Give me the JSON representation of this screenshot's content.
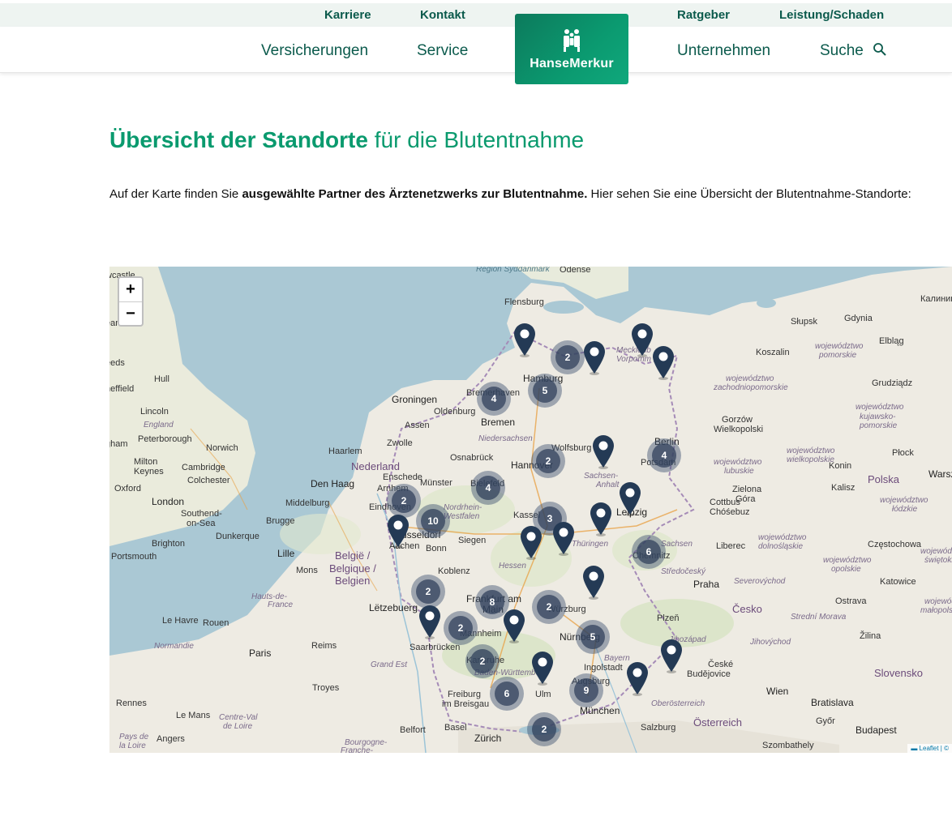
{
  "topnav": {
    "karriere": "Karriere",
    "kontakt": "Kontakt",
    "ratgeber": "Ratgeber",
    "leistung": "Leistung/Schaden"
  },
  "mainnav": {
    "versicherungen": "Versicherungen",
    "service": "Service",
    "unternehmen": "Unternehmen",
    "suche": "Suche"
  },
  "logo": {
    "text": "HanseMerkur"
  },
  "page": {
    "title_bold": "Übersicht der Standorte",
    "title_rest": " für die Blutentnahme",
    "intro_pre": "Auf der Karte finden Sie ",
    "intro_bold": "ausgewählte Partner des Ärztenetzwerks zur Blutentnahme.",
    "intro_post": "  Hier sehen Sie eine Übersicht der Blutentnahme-Standorte:"
  },
  "map": {
    "zoom_in": "+",
    "zoom_out": "−",
    "attribution": "▬ Leaflet | ©",
    "clusters": [
      "2",
      "4",
      "5",
      "2",
      "4",
      "4",
      "2",
      "10",
      "3",
      "6",
      "2",
      "8",
      "2",
      "2",
      "5",
      "2",
      "6",
      "9",
      "2"
    ],
    "labels": {
      "odense": "Odense",
      "flensburg": "Flensburg",
      "region_syd": "Region Syddanmark",
      "hamburg": "Hamburg",
      "bremen": "Bremen",
      "bremerhaven": "Bremerhaven",
      "oldenburg": "Oldenburg",
      "groningen": "Groningen",
      "assen": "Assen",
      "zwolle": "Zwolle",
      "haarlem": "Haarlem",
      "nederland": "Nederland",
      "den_haag": "Den Haag",
      "middelburg": "Middelburg",
      "brugge": "Brugge",
      "dunkerque": "Dunkerque",
      "lille": "Lille",
      "belgie": "België /",
      "belgique": "Belgique /",
      "belgien": "Belgien",
      "mons": "Mons",
      "letzebuerg": "Lëtzebuerg",
      "reims": "Reims",
      "paris": "Paris",
      "rouen": "Rouen",
      "le_havre": "Le Havre",
      "troyes": "Troyes",
      "le_mans": "Le Mans",
      "rennes": "Rennes",
      "angers": "Angers",
      "normandie": "Normandie",
      "grand_est": "Grand Est",
      "hauts_de": "Hauts-de-",
      "france": "France",
      "centre": "Centre-Val",
      "de_loire": "de Loire",
      "pays": "Pays de",
      "la_loire": "la Loire",
      "bourgogne": "Bourgogne-",
      "franche": "Franche-",
      "london": "London",
      "leeds": "eeds",
      "sheffield": "heffield",
      "hull": "Hull",
      "lincoln": "Lincoln",
      "england": "England",
      "gham": "gham",
      "peterborough": "Peterborough",
      "norwich": "Norwich",
      "milton": "Milton",
      "keynes": "Keynes",
      "cambridge": "Cambridge",
      "colchester": "Colchester",
      "oxford": "Oxford",
      "southend": "Southend-",
      "on_sea": "on-Sea",
      "brighton": "Brighton",
      "portsmouth": "Portsmouth",
      "ewcastle": "wcastle",
      "eam": "eam",
      "enschede": "Enschede",
      "osnabrueck": "Osnabrück",
      "muenster": "Münster",
      "arnhem": "Arnhem",
      "eindhoven": "Eindhoven",
      "duesseldorf": "üsseldorf",
      "aachen": "Aachen",
      "bonn": "Bonn",
      "siegen": "Siegen",
      "koblenz": "Koblenz",
      "hannover": "Hannover",
      "wolfsburg": "Wolfsburg",
      "niedersachsen": "Niedersachsen",
      "bielefeld": "Bielefeld",
      "nordrhein": "Nordrhein-",
      "westfalen": "Westfalen",
      "kassel": "Kassel",
      "hessen": "Hessen",
      "frankfurt": "Frankfurt am",
      "main": "Main",
      "mannheim": "Mannheim",
      "saarbruecken": "Saarbrücken",
      "karlsruhe": "Karlsruhe",
      "baden": "Baden-Württemberg",
      "freiburg": "Freiburg",
      "im_breisgau": "im Breisgau",
      "basel": "Basel",
      "zuerich": "Zürich",
      "belfort": "Belfort",
      "ulm": "Ulm",
      "augsburg": "Augsburg",
      "muenchen": "München",
      "ingolstadt": "Ingolstadt",
      "nuernberg": "Nürnberg",
      "wuerzburg": "Würzburg",
      "bayern": "Bayern",
      "sachsen_anhalt": "Sachsen-",
      "anhalt": "Anhalt",
      "leipzig": "Leipzig",
      "thueringen": "Thüringen",
      "chemnitz": "Chemnitz",
      "sachsen": "Sachsen",
      "berlin": "Berlin",
      "potsdam": "Potsdam",
      "cottbus": "Cottbus",
      "chosebuz": "Chóśebuz",
      "mecklenburg": "Mecklenb",
      "vorpommern": "Vorpomm",
      "koszalin": "Koszalin",
      "slupsk": "Słupsk",
      "gdynia": "Gdynia",
      "elblag": "Elbląg",
      "pomorskie": "pomorskie",
      "wojewodztwo": "województwo",
      "zachodniopomorskie": "zachodniopomorskie",
      "grudziadz": "Grudziądz",
      "kujawsko": "kujawsko-",
      "gorzow": "Gorzów",
      "wielkopolski": "Wielkopolski",
      "wielkopolskie": "wielkopolskie",
      "lubuskie": "lubuskie",
      "konin": "Konin",
      "plock": "Płock",
      "warsz": "Warsz",
      "polska": "Polska",
      "kalisz": "Kalisz",
      "zielona": "Zielona",
      "gora": "Góra",
      "lodzkie": "łódzkie",
      "dolnoslaskie": "dolnośląskie",
      "liberec": "Liberec",
      "czestochowa": "Częstochowa",
      "opolskie": "opolskie",
      "slaskie": "śląskie",
      "swietokrz": "świętokrz",
      "katowice": "Katowice",
      "praha": "Praha",
      "cesko": "Česko",
      "stredocesky": "Středočeský",
      "severovychod": "Severovýchod",
      "plzen": "Plzeň",
      "jihovychod": "Jihovýchod",
      "ostrava": "Ostrava",
      "moravia": "Strední Morava",
      "malopolskie": "małopolskie",
      "zilina": "Žilina",
      "ceske": "České",
      "budejovice": "Budějovice",
      "jihozapad": "Jihozápad",
      "slovensko": "Slovensko",
      "wien": "Wien",
      "bratislava": "Bratislava",
      "gyor": "Győr",
      "oesterreich": "Österreich",
      "oberoesterreich": "Oberösterreich",
      "salzburg": "Salzburg",
      "budapest": "Budapest",
      "szombathely": "Szombathely",
      "kalinin": "Калинин"
    }
  },
  "colors": {
    "brand_green": "#0a9a6e",
    "nav_text": "#0b5a4c",
    "marker": "#243a55"
  }
}
